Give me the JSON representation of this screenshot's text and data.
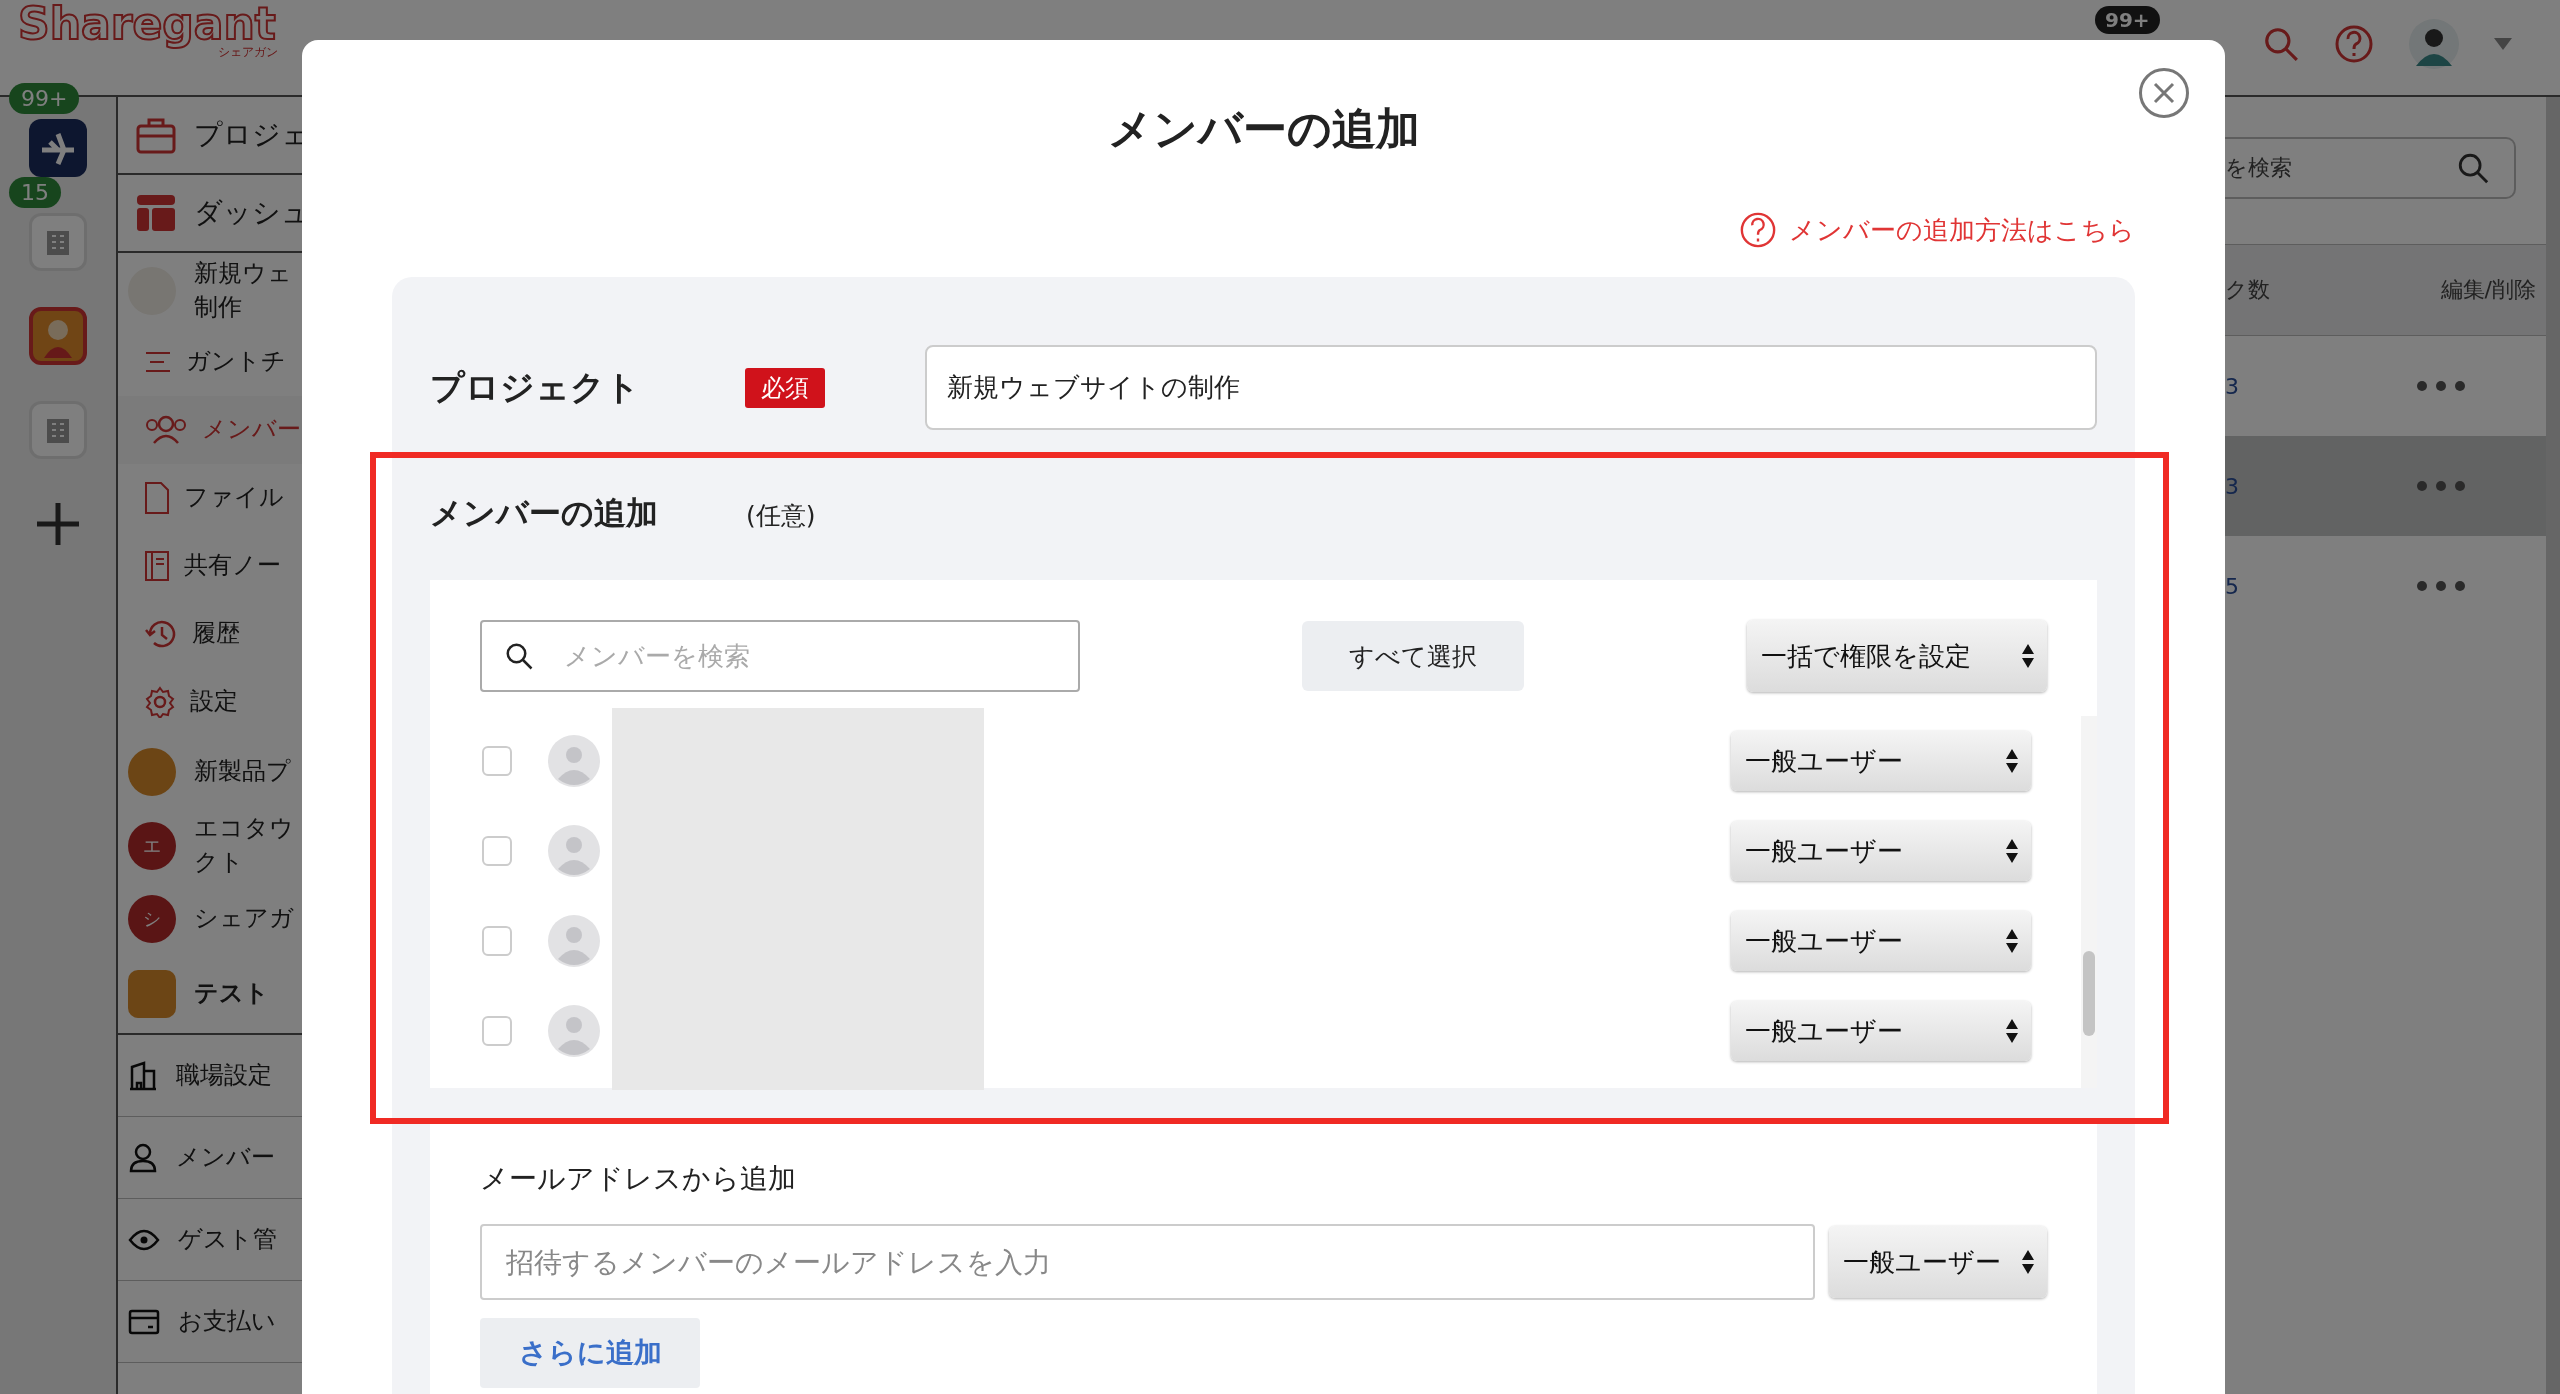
{
  "header": {
    "logo": "Sharegant",
    "logo_sub": "シェアガン",
    "notification_badge": "99+"
  },
  "rail": {
    "items": [
      {
        "kind": "app",
        "badge": "99+",
        "selected": false
      },
      {
        "kind": "building",
        "badge": "15",
        "selected": false
      },
      {
        "kind": "mascot",
        "selected": true
      },
      {
        "kind": "building",
        "selected": false
      },
      {
        "kind": "add",
        "selected": false
      }
    ]
  },
  "sidebar": {
    "items": [
      {
        "kind": "section",
        "label": "プロジェ"
      },
      {
        "kind": "section",
        "label": "ダッシュ"
      },
      {
        "kind": "project",
        "label": "新規ウェ",
        "label_2": "制作"
      },
      {
        "kind": "sub",
        "label": "ガントチ",
        "selected": false
      },
      {
        "kind": "sub",
        "label": "メンバー",
        "selected": true
      },
      {
        "kind": "sub",
        "label": "ファイル",
        "selected": false
      },
      {
        "kind": "sub",
        "label": "共有ノー",
        "selected": false
      },
      {
        "kind": "sub",
        "label": "履歴",
        "selected": false
      },
      {
        "kind": "sub",
        "label": "設定",
        "selected": false
      },
      {
        "kind": "project",
        "label": "新製品プ"
      },
      {
        "kind": "project",
        "label": "エコタウ",
        "label_2": "クト",
        "letter": "エ"
      },
      {
        "kind": "project",
        "label": "シェアガ",
        "letter": "シ"
      },
      {
        "kind": "workspace",
        "label": "テスト"
      },
      {
        "kind": "setting",
        "label": "職場設定"
      },
      {
        "kind": "setting",
        "label": "メンバー"
      },
      {
        "kind": "setting",
        "label": "ゲスト管"
      },
      {
        "kind": "setting",
        "label": "お支払い"
      }
    ]
  },
  "background_table": {
    "search_fragment": "を検索",
    "columns": [
      "ク数",
      "編集/削除"
    ],
    "rows": [
      {
        "count": "3",
        "selected": false
      },
      {
        "count": "3",
        "selected": true
      },
      {
        "count": "5",
        "selected": false
      }
    ]
  },
  "modal": {
    "title": "メンバーの追加",
    "help_link": "メンバーの追加方法はこちら",
    "project": {
      "label": "プロジェクト",
      "required_badge": "必須",
      "value": "新規ウェブサイトの制作"
    },
    "members": {
      "title": "メンバーの追加",
      "optional": "(任意)",
      "search_placeholder": "メンバーを検索",
      "select_all": "すべて選択",
      "bulk_permission": "一括で権限を設定",
      "rows": [
        {
          "checked": false,
          "role": "一般ユーザー"
        },
        {
          "checked": false,
          "role": "一般ユーザー"
        },
        {
          "checked": false,
          "role": "一般ユーザー"
        },
        {
          "checked": false,
          "role": "一般ユーザー"
        }
      ]
    },
    "email": {
      "label": "メールアドレスから追加",
      "placeholder": "招待するメンバーのメールアドレスを入力",
      "role": "一般ユーザー",
      "add_more": "さらに追加"
    }
  }
}
